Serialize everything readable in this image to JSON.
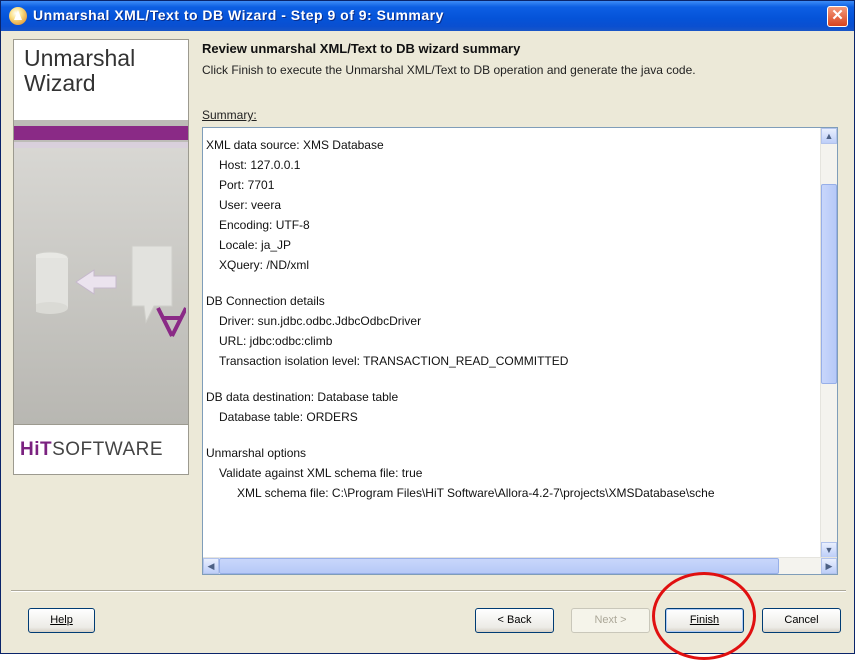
{
  "window": {
    "title": "Unmarshal XML/Text to DB Wizard - Step 9 of 9: Summary",
    "close_label": "✕"
  },
  "left_panel": {
    "title": "Unmarshal Wizard",
    "logo_hi": "HiT",
    "logo_rest": "SOFTWARE",
    "illustration_icon": "database-export-icon",
    "accent_color": "#8a2a86"
  },
  "header": {
    "title": "Review unmarshal XML/Text to DB wizard summary",
    "description": "Click Finish to execute the Unmarshal XML/Text to DB operation and generate the java code."
  },
  "summary": {
    "label": "Summary:",
    "lines": [
      {
        "indent": 0,
        "text": "XML data source: XMS Database"
      },
      {
        "indent": 1,
        "text": "Host: 127.0.0.1"
      },
      {
        "indent": 1,
        "text": "Port: 7701"
      },
      {
        "indent": 1,
        "text": "User: veera"
      },
      {
        "indent": 1,
        "text": "Encoding: UTF-8"
      },
      {
        "indent": 1,
        "text": "Locale: ja_JP"
      },
      {
        "indent": 1,
        "text": "XQuery: /ND/xml"
      },
      {
        "indent": -1,
        "text": ""
      },
      {
        "indent": 0,
        "text": "DB Connection details"
      },
      {
        "indent": 1,
        "text": "Driver: sun.jdbc.odbc.JdbcOdbcDriver"
      },
      {
        "indent": 1,
        "text": "URL: jdbc:odbc:climb"
      },
      {
        "indent": 1,
        "text": "Transaction isolation level: TRANSACTION_READ_COMMITTED"
      },
      {
        "indent": -1,
        "text": ""
      },
      {
        "indent": 0,
        "text": "DB data destination: Database table"
      },
      {
        "indent": 1,
        "text": "Database table: ORDERS"
      },
      {
        "indent": -1,
        "text": ""
      },
      {
        "indent": 0,
        "text": "Unmarshal options"
      },
      {
        "indent": 1,
        "text": "Validate against XML schema file: true"
      },
      {
        "indent": 2,
        "text": "XML schema file: C:\\Program Files\\HiT Software\\Allora-4.2-7\\projects\\XMSDatabase\\sche"
      }
    ]
  },
  "buttons": {
    "help": "Help",
    "back": "< Back",
    "next": "Next >",
    "finish": "Finish",
    "cancel": "Cancel"
  },
  "highlight_color": "#e01010"
}
